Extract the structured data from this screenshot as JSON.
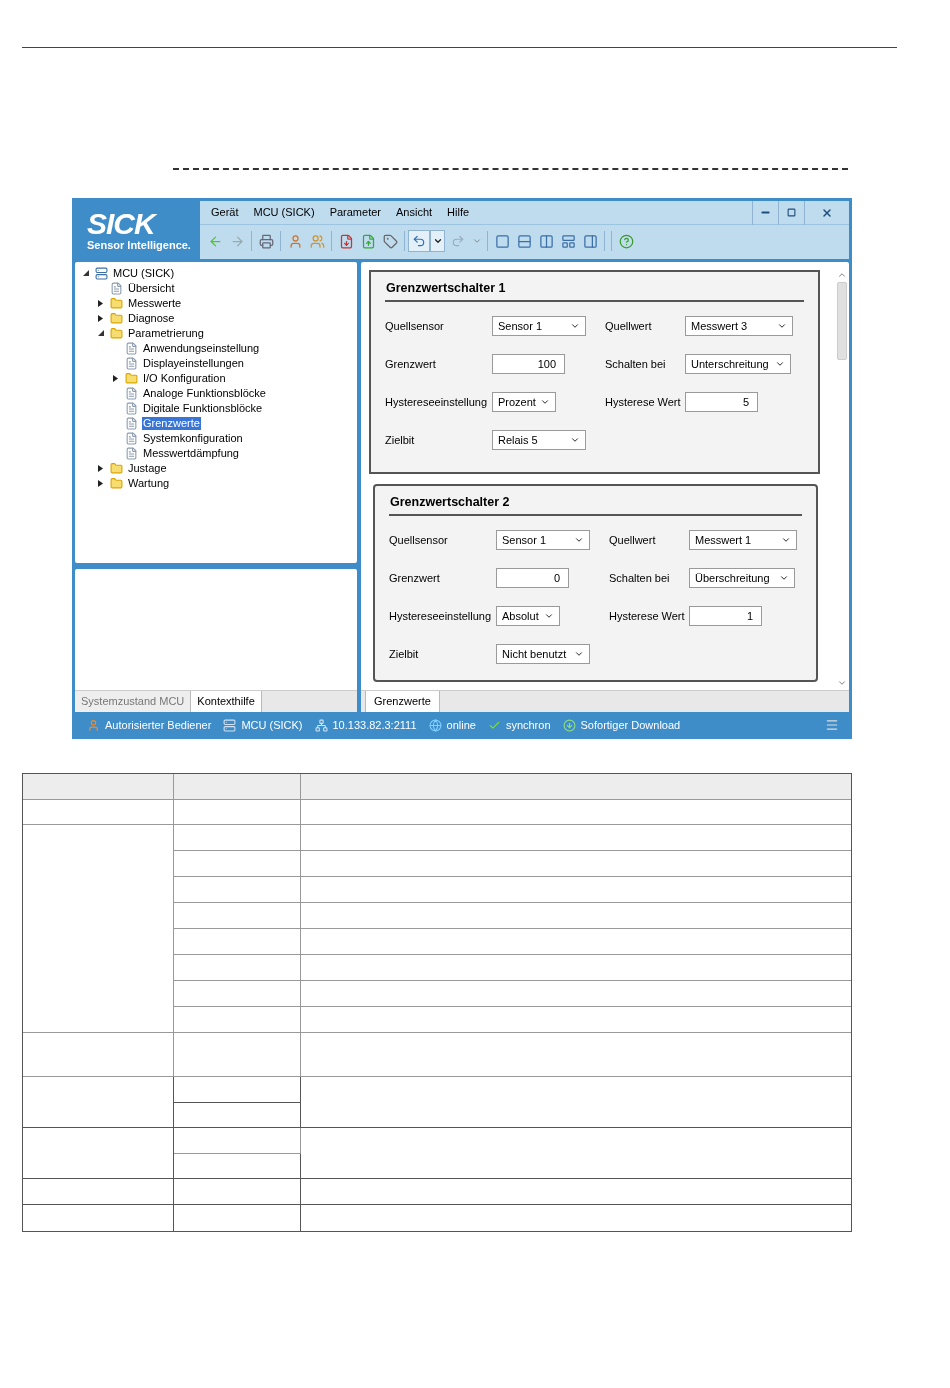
{
  "logo": {
    "brand": "SICK",
    "tagline": "Sensor Intelligence."
  },
  "menu": [
    "Gerät",
    "MCU (SICK)",
    "Parameter",
    "Ansicht",
    "Hilfe"
  ],
  "tree": [
    {
      "label": "MCU (SICK)",
      "kind": "device",
      "expanded": true,
      "selected": false,
      "children": [
        {
          "label": "Übersicht",
          "kind": "page",
          "selected": false
        },
        {
          "label": "Messwerte",
          "kind": "folder",
          "expanded": false,
          "selected": false
        },
        {
          "label": "Diagnose",
          "kind": "folder",
          "expanded": false,
          "selected": false
        },
        {
          "label": "Parametrierung",
          "kind": "folder",
          "expanded": true,
          "selected": false,
          "children": [
            {
              "label": "Anwendungseinstellung",
              "kind": "page",
              "selected": false
            },
            {
              "label": "Displayeinstellungen",
              "kind": "page",
              "selected": false
            },
            {
              "label": "I/O Konfiguration",
              "kind": "folder",
              "expanded": false,
              "selected": false
            },
            {
              "label": "Analoge Funktionsblöcke",
              "kind": "page",
              "selected": false
            },
            {
              "label": "Digitale Funktionsblöcke",
              "kind": "page",
              "selected": false
            },
            {
              "label": "Grenzwerte",
              "kind": "page",
              "selected": true
            },
            {
              "label": "Systemkonfiguration",
              "kind": "page",
              "selected": false
            },
            {
              "label": "Messwertdämpfung",
              "kind": "page",
              "selected": false
            }
          ]
        },
        {
          "label": "Justage",
          "kind": "folder",
          "expanded": false,
          "selected": false
        },
        {
          "label": "Wartung",
          "kind": "folder",
          "expanded": false,
          "selected": false
        }
      ]
    }
  ],
  "left_tabs": [
    {
      "label": "Systemzustand MCU",
      "selected": false
    },
    {
      "label": "Kontexthilfe",
      "selected": true
    }
  ],
  "groups": [
    {
      "title": "Grenzwertschalter 1",
      "rows": [
        {
          "left": {
            "label": "Quellsensor",
            "kind": "select",
            "value": "Sensor 1"
          },
          "right": {
            "label": "Quellwert",
            "kind": "select",
            "value": "Messwert 3"
          }
        },
        {
          "left": {
            "label": "Grenzwert",
            "kind": "input",
            "value": "100"
          },
          "right": {
            "label": "Schalten bei",
            "kind": "select",
            "value": "Unterschreitung"
          }
        },
        {
          "left": {
            "label": "Hystereseeinstellung",
            "kind": "select",
            "value": "Prozent"
          },
          "right": {
            "label": "Hysterese Wert",
            "kind": "input",
            "value": "5"
          }
        },
        {
          "left": {
            "label": "Zielbit",
            "kind": "select",
            "value": "Relais 5"
          }
        }
      ]
    },
    {
      "title": "Grenzwertschalter 2",
      "rows": [
        {
          "left": {
            "label": "Quellsensor",
            "kind": "select",
            "value": "Sensor 1"
          },
          "right": {
            "label": "Quellwert",
            "kind": "select",
            "value": "Messwert 1"
          }
        },
        {
          "left": {
            "label": "Grenzwert",
            "kind": "input",
            "value": "0"
          },
          "right": {
            "label": "Schalten bei",
            "kind": "select",
            "value": "Überschreitung"
          }
        },
        {
          "left": {
            "label": "Hystereseeinstellung",
            "kind": "select",
            "value": "Absolut"
          },
          "right": {
            "label": "Hysterese Wert",
            "kind": "input",
            "value": "1"
          }
        },
        {
          "left": {
            "label": "Zielbit",
            "kind": "select",
            "value": "Nicht benutzt"
          }
        }
      ]
    }
  ],
  "right_tabs": [
    {
      "label": "Grenzwerte",
      "selected": true
    }
  ],
  "status_bar": [
    {
      "kind": "user",
      "text": "Autorisierter Bediener"
    },
    {
      "kind": "device",
      "text": "MCU (SICK)"
    },
    {
      "kind": "network",
      "text": "10.133.82.3:2111"
    },
    {
      "kind": "globe",
      "text": "online"
    },
    {
      "kind": "check",
      "text": "synchron"
    },
    {
      "kind": "download",
      "text": "Sofortiger Download"
    }
  ]
}
